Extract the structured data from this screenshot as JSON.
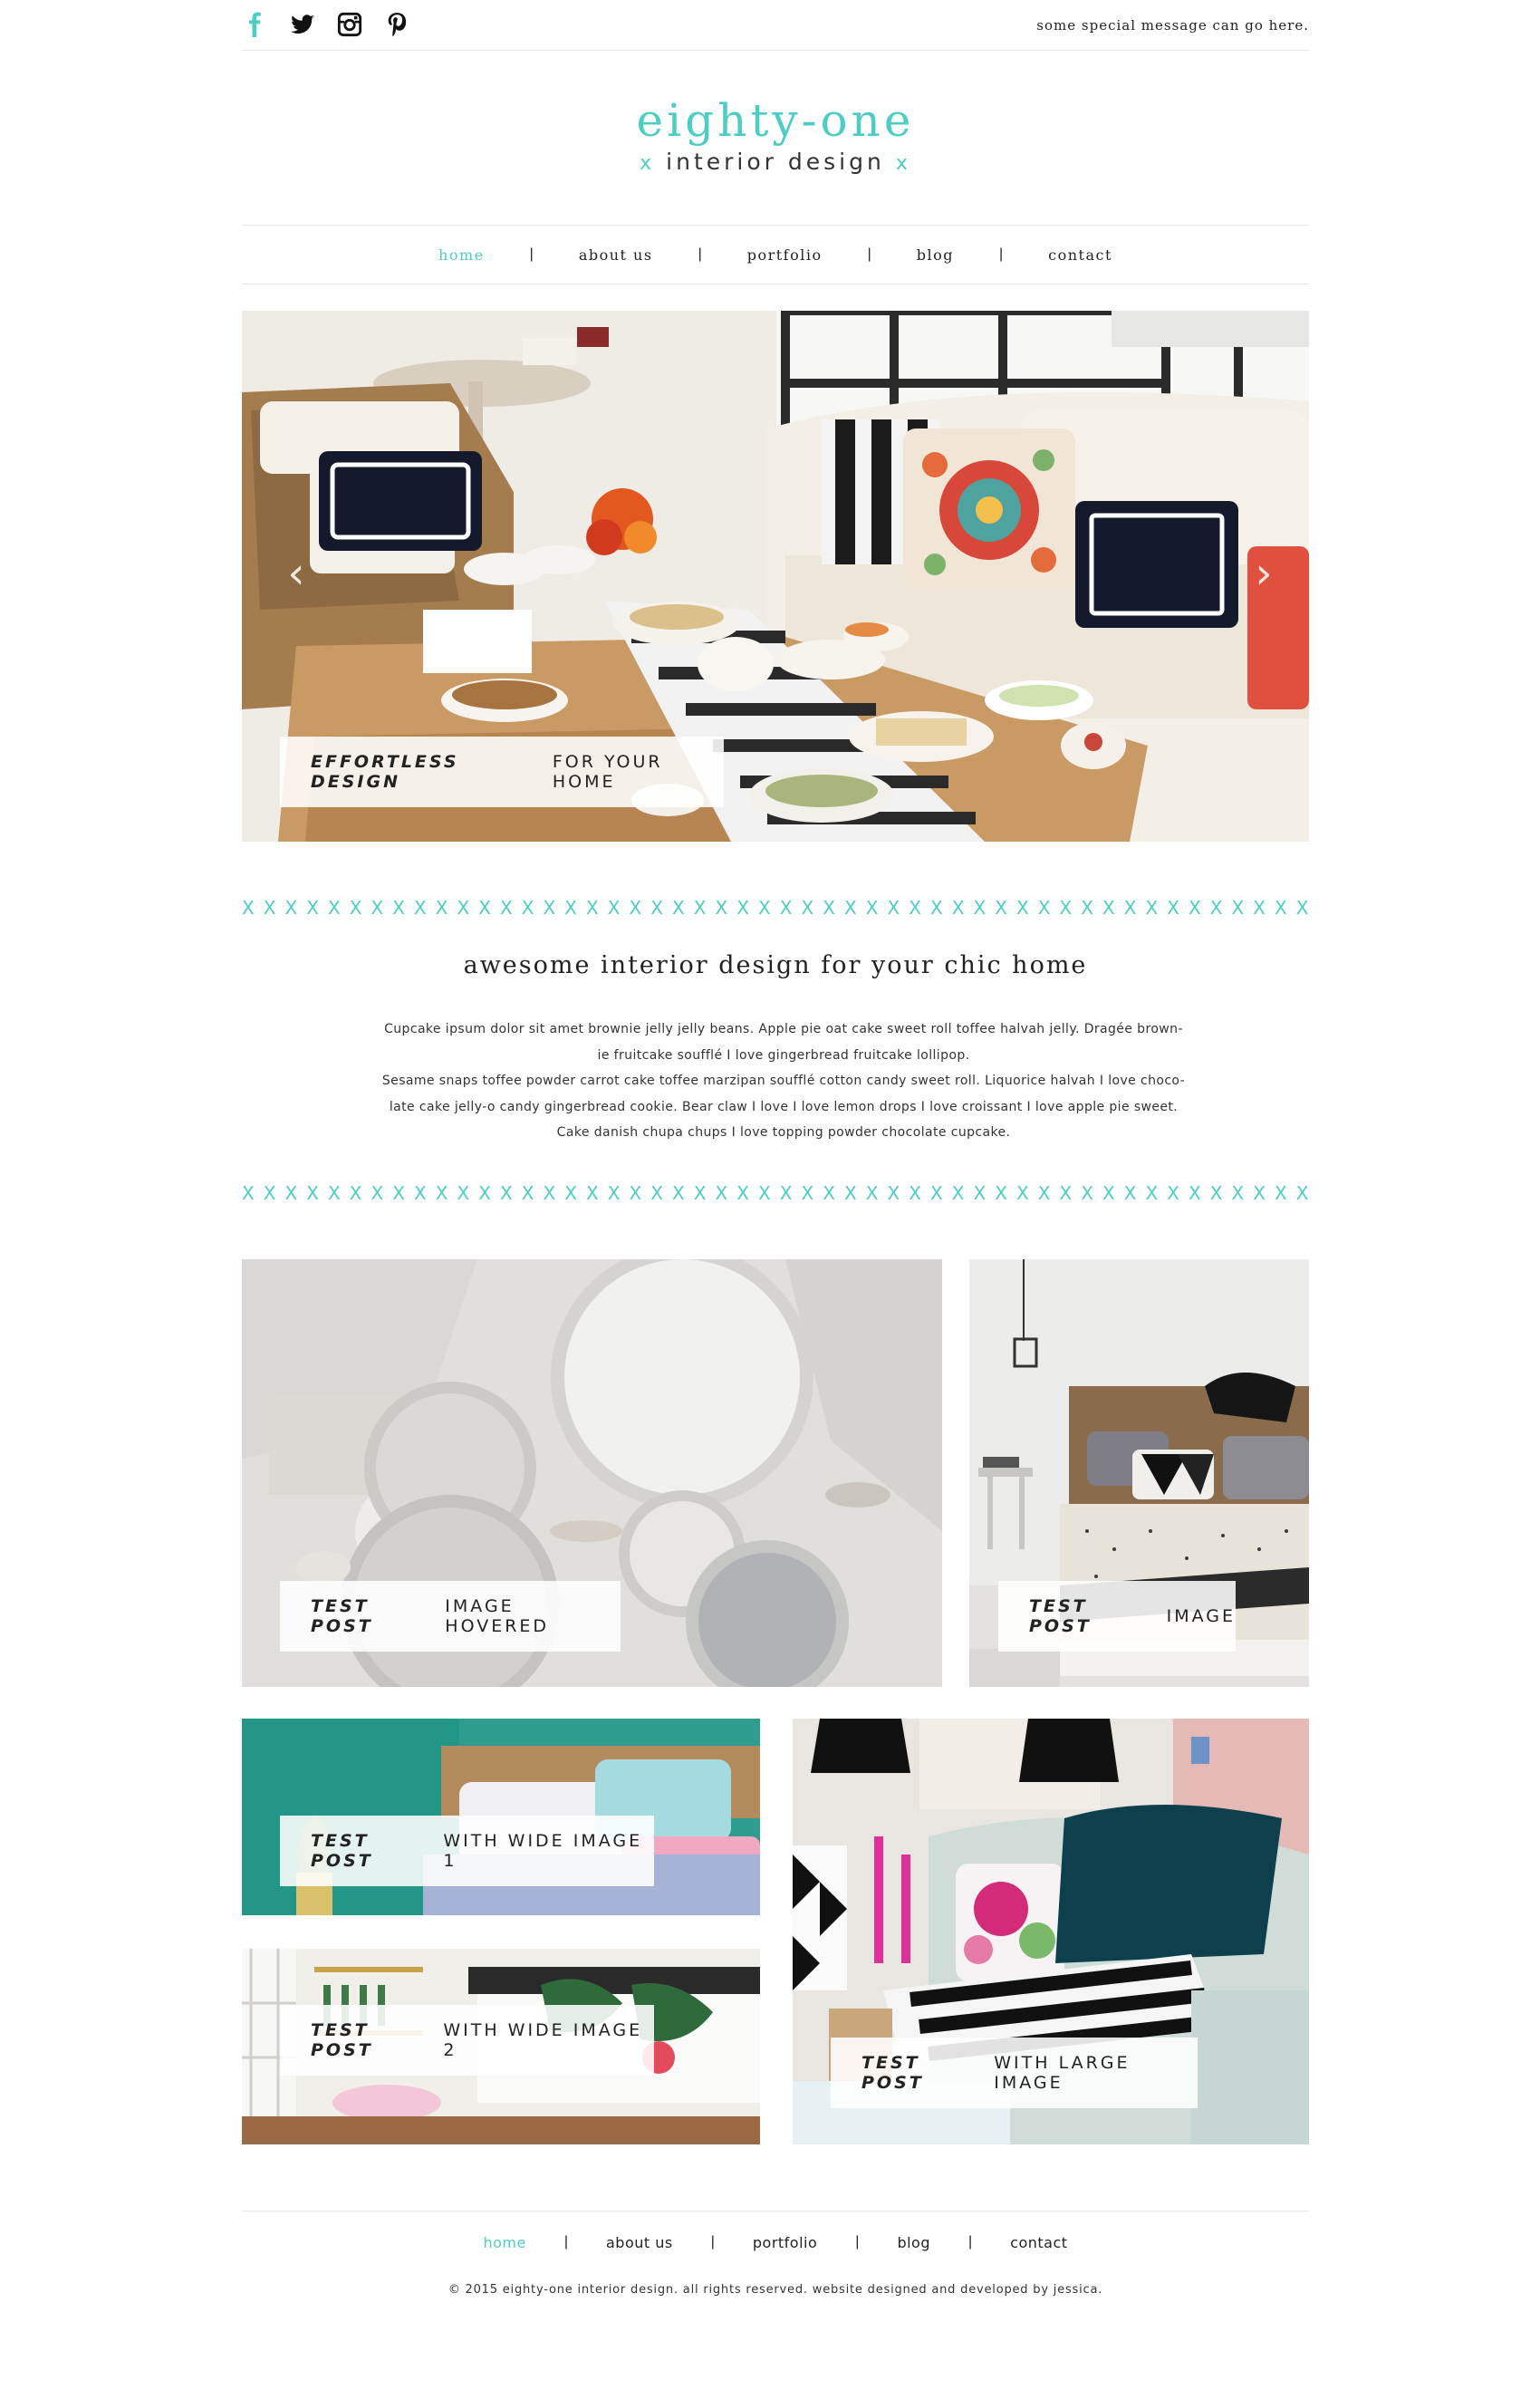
{
  "topbar": {
    "social": [
      "facebook-icon",
      "twitter-icon",
      "instagram-icon",
      "pinterest-icon"
    ],
    "message": "some special message can go here."
  },
  "logo": {
    "title": "eighty-one",
    "subtitle": "interior design",
    "x_mark": "x"
  },
  "nav": {
    "items": [
      "home",
      "about us",
      "portfolio",
      "blog",
      "contact"
    ],
    "active": "home",
    "separator": "|"
  },
  "hero": {
    "caption_bold": "EFFORTLESS DESIGN",
    "caption_rest": "FOR YOUR HOME",
    "prev_arrow": "‹",
    "next_arrow": "›"
  },
  "divider_char": "X",
  "intro": {
    "heading": "awesome interior design for your chic home",
    "lines": [
      "Cupcake ipsum dolor sit amet brownie jelly jelly beans. Apple pie oat cake sweet roll toffee halvah jelly. Dragée brown-",
      "ie fruitcake soufflé I love gingerbread fruitcake lollipop.",
      "Sesame snaps toffee powder carrot cake toffee marzipan soufflé cotton candy sweet roll. Liquorice halvah I love choco-",
      "late cake jelly-o candy gingerbread cookie. Bear claw I love I love lemon drops I love croissant I love apple pie sweet.",
      "Cake danish chupa chups I love topping powder chocolate cupcake."
    ]
  },
  "posts": [
    {
      "bold": "TEST POST",
      "rest": "IMAGE HOVERED"
    },
    {
      "bold": "TEST POST",
      "rest": "IMAGE"
    },
    {
      "bold": "TEST POST",
      "rest": "WITH WIDE IMAGE 1"
    },
    {
      "bold": "TEST POST",
      "rest": "WITH WIDE IMAGE 2"
    },
    {
      "bold": "TEST POST",
      "rest": "WITH LARGE IMAGE"
    }
  ],
  "footer": {
    "items": [
      "home",
      "about us",
      "portfolio",
      "blog",
      "contact"
    ],
    "active": "home",
    "separator": "|",
    "copyright": "© 2015 eighty-one interior design. all rights reserved. website designed and developed by jessica."
  },
  "colors": {
    "accent": "#4ecdc4",
    "text": "#222222",
    "rule": "#e6e6e6"
  }
}
